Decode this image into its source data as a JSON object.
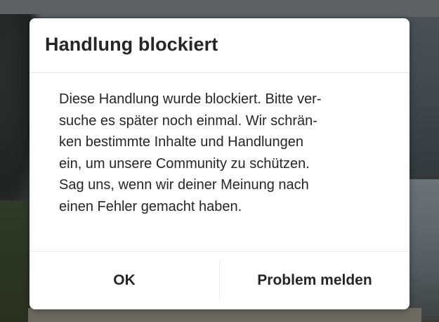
{
  "dialog": {
    "title": "Handlung blockiert",
    "message_lines": [
      "Diese Handlung wurde blockiert. Bitte ver-",
      "suche es später noch einmal. Wir schrän-",
      "ken bestimmte Inhalte und Handlungen",
      "ein, um unsere Community zu schützen.",
      "Sag uns, wenn wir deiner Meinung nach",
      "einen Fehler gemacht haben."
    ],
    "buttons": {
      "ok_label": "OK",
      "report_label": "Problem melden"
    }
  },
  "colors": {
    "dialog_background": "#ffffff",
    "text": "#262626",
    "divider": "#e4e4e4"
  }
}
